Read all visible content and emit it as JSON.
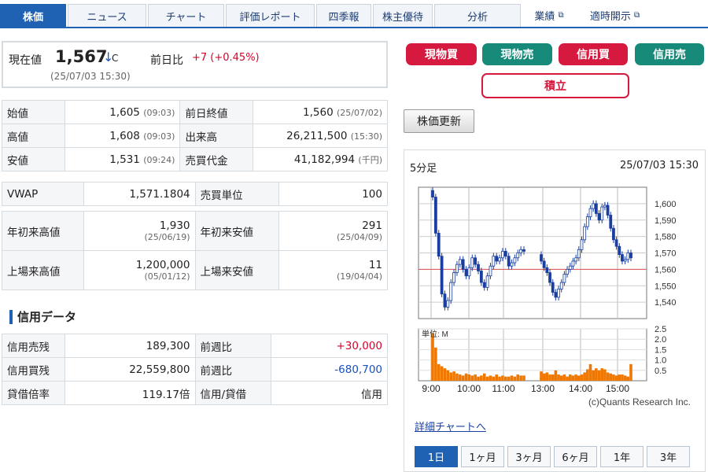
{
  "tabs": [
    {
      "label": "株価",
      "active": true
    },
    {
      "label": "ニュース"
    },
    {
      "label": "チャート"
    },
    {
      "label": "評価レポート"
    },
    {
      "label": "四季報"
    },
    {
      "label": "株主優待"
    },
    {
      "label": "分析"
    },
    {
      "label": "業績",
      "external": true
    },
    {
      "label": "適時開示",
      "external": true
    }
  ],
  "price": {
    "label": "現在値",
    "value": "1,567",
    "arrow": "↓",
    "mark": "C",
    "change_label": "前日比",
    "change": "+7 (+0.45%)",
    "time": "(25/07/03 15:30)"
  },
  "stats1": [
    {
      "l1": "始値",
      "v1": "1,605",
      "t1": "(09:03)",
      "l2": "前日終値",
      "v2": "1,560",
      "t2": "(25/07/02)"
    },
    {
      "l1": "高値",
      "v1": "1,608",
      "t1": "(09:03)",
      "l2": "出来高",
      "v2": "26,211,500",
      "t2": "(15:30)"
    },
    {
      "l1": "安値",
      "v1": "1,531",
      "t1": "(09:24)",
      "l2": "売買代金",
      "v2": "41,182,994",
      "t2": "(千円)"
    }
  ],
  "stats2": {
    "l1": "VWAP",
    "v1": "1,571.1804",
    "l2": "売買単位",
    "v2": "100"
  },
  "stats3": [
    {
      "l1": "年初来高値",
      "v1": "1,930",
      "t1": "(25/06/19)",
      "l2": "年初来安値",
      "v2": "291",
      "t2": "(25/04/09)"
    },
    {
      "l1": "上場来高値",
      "v1": "1,200,000",
      "t1": "(05/01/12)",
      "l2": "上場来安値",
      "v2": "11",
      "t2": "(19/04/04)"
    }
  ],
  "credit": {
    "title": "信用データ",
    "rows": [
      {
        "l1": "信用売残",
        "v1": "189,300",
        "l2": "前週比",
        "v2": "+30,000"
      },
      {
        "l1": "信用買残",
        "v1": "22,559,800",
        "l2": "前週比",
        "v2": "-680,700"
      },
      {
        "l1": "貸借倍率",
        "v1": "119.17倍",
        "l2": "信用/貸借",
        "v2": "信用"
      }
    ]
  },
  "actions": {
    "buy": "現物買",
    "sell": "現物売",
    "margin_buy": "信用買",
    "margin_sell": "信用売",
    "accumulate": "積立",
    "update": "株価更新"
  },
  "chart_panel": {
    "title": "5分足",
    "time": "25/07/03 15:30",
    "volume_unit": "単位: M",
    "credit": "(c)Quants Research Inc.",
    "detail_link": "詳細チャートへ"
  },
  "periods": [
    {
      "label": "1日",
      "active": true
    },
    {
      "label": "1ヶ月"
    },
    {
      "label": "3ヶ月"
    },
    {
      "label": "6ヶ月"
    },
    {
      "label": "1年"
    },
    {
      "label": "3年"
    }
  ],
  "colors": {
    "accent": "#1f62b3",
    "up": "#d9002a",
    "down": "#1a4fc0",
    "volume": "#f07800",
    "prev_close_line": "#e05050"
  },
  "chart_data": [
    {
      "type": "candlestick",
      "ylim": [
        1530,
        1610
      ],
      "yticks": [
        1540,
        1550,
        1560,
        1570,
        1580,
        1590,
        1600
      ],
      "xticks": [
        "9:00",
        "10:00",
        "11:00",
        "13:00",
        "14:00",
        "15:00"
      ],
      "reference_line": 1560,
      "grid": true,
      "series": [
        {
          "session": "am",
          "close": [
            1604,
            1582,
            1568,
            1545,
            1537,
            1541,
            1552,
            1558,
            1563,
            1566,
            1560,
            1556,
            1561,
            1567,
            1563,
            1559,
            1552,
            1549,
            1556,
            1562,
            1568,
            1565,
            1567,
            1571,
            1568,
            1562,
            1564,
            1567,
            1570,
            1572,
            1571
          ]
        },
        {
          "session": "pm",
          "close": [
            1565,
            1561,
            1558,
            1552,
            1546,
            1543,
            1548,
            1552,
            1557,
            1560,
            1562,
            1565,
            1567,
            1572,
            1578,
            1586,
            1592,
            1597,
            1600,
            1594,
            1590,
            1598,
            1599,
            1593,
            1585,
            1578,
            1574,
            1569,
            1565,
            1566,
            1570,
            1567
          ]
        }
      ]
    },
    {
      "type": "bar",
      "ylabel": "単位: M",
      "ylim": [
        0,
        2.5
      ],
      "yticks": [
        0.5,
        1.0,
        1.5,
        2.0,
        2.5
      ],
      "series": [
        {
          "session": "am",
          "values": [
            2.3,
            1.6,
            0.8,
            0.7,
            0.6,
            0.5,
            0.4,
            0.45,
            0.35,
            0.3,
            0.25,
            0.35,
            0.3,
            0.25,
            0.3,
            0.2,
            0.25,
            0.35,
            0.2,
            0.25,
            0.2,
            0.3,
            0.2,
            0.25,
            0.2,
            0.2,
            0.25,
            0.2,
            0.3,
            0.25,
            0.25
          ]
        },
        {
          "session": "pm",
          "values": [
            0.45,
            0.35,
            0.4,
            0.3,
            0.3,
            0.5,
            0.3,
            0.25,
            0.3,
            0.2,
            0.3,
            0.25,
            0.3,
            0.25,
            0.3,
            0.4,
            0.55,
            0.8,
            0.5,
            0.6,
            0.5,
            0.6,
            0.55,
            0.4,
            0.35,
            0.3,
            0.25,
            0.3,
            0.3,
            0.25,
            0.2,
            0.8
          ]
        }
      ]
    }
  ]
}
